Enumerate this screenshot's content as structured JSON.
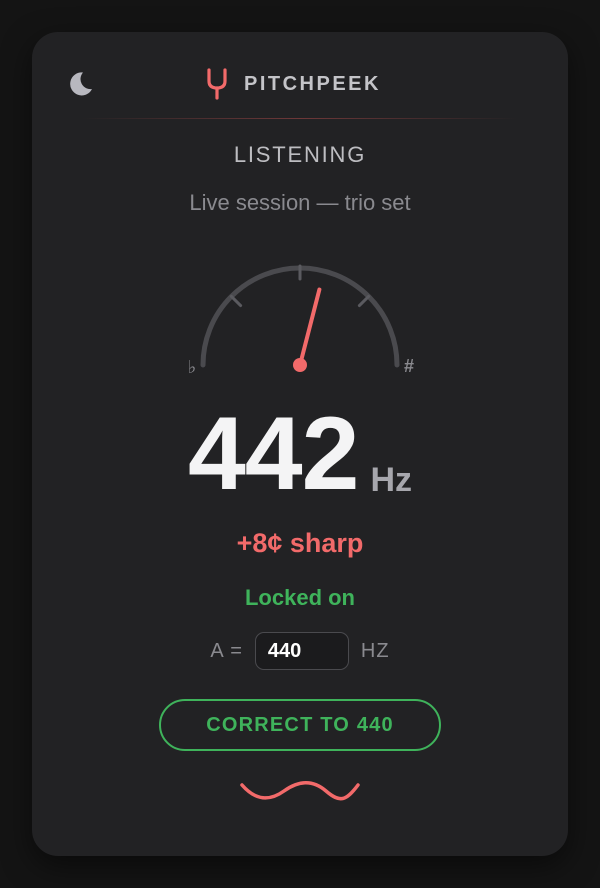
{
  "header": {
    "brand": "PITCHPEEK",
    "theme_icon": "moon-icon",
    "logo_icon": "tuning-fork-icon"
  },
  "status": {
    "state": "LISTENING",
    "session": "Live session — trio set"
  },
  "gauge": {
    "flat_symbol": "♭",
    "sharp_symbol": "#",
    "cents_min": -50,
    "cents_max": 50,
    "needle_cents": 8,
    "needle_color": "#f26a6a",
    "arc_color": "#4a4a4e"
  },
  "reading": {
    "frequency": "442",
    "unit": "Hz",
    "cents_text": "+8¢ sharp",
    "lock_text": "Locked on"
  },
  "reference": {
    "prefix": "A =",
    "value": "440",
    "suffix": "HZ"
  },
  "actions": {
    "correct_label": "CORRECT TO 440"
  },
  "colors": {
    "accent": "#f26a6a",
    "success": "#3fb35b",
    "card_bg": "#222224",
    "page_bg": "#141414"
  }
}
